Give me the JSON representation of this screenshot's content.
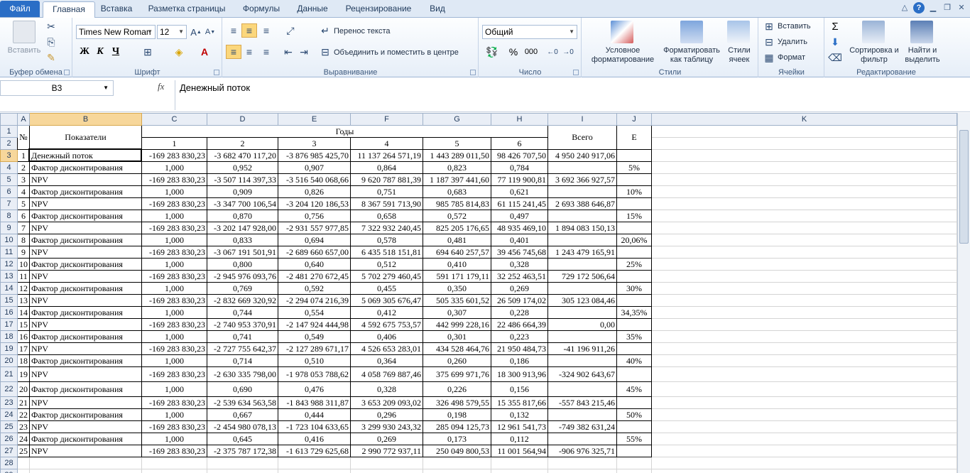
{
  "tabs": {
    "file": "Файл",
    "items": [
      "Главная",
      "Вставка",
      "Разметка страницы",
      "Формулы",
      "Данные",
      "Рецензирование",
      "Вид"
    ]
  },
  "ribbon": {
    "clipboard": {
      "paste": "Вставить",
      "label": "Буфер обмена"
    },
    "font": {
      "name": "Times New Roman",
      "size": "12",
      "bold": "Ж",
      "italic": "К",
      "underline": "Ч",
      "label": "Шрифт"
    },
    "alignment": {
      "wrap": "Перенос текста",
      "merge": "Объединить и поместить в центре",
      "label": "Выравнивание"
    },
    "number": {
      "format": "Общий",
      "percent": "%",
      "thousands": "000",
      "label": "Число"
    },
    "styles": {
      "conditional": "Условное форматирование",
      "table": "Форматировать как таблицу",
      "cell": "Стили ячеек",
      "label": "Стили"
    },
    "cells": {
      "insert": "Вставить",
      "delete": "Удалить",
      "format": "Формат",
      "label": "Ячейки"
    },
    "editing": {
      "sort": "Сортировка и фильтр",
      "find": "Найти и выделить",
      "label": "Редактирование"
    }
  },
  "formula_bar": {
    "namebox": "B3",
    "fx": "fx",
    "content": "Денежный поток"
  },
  "columns": [
    "A",
    "B",
    "C",
    "D",
    "E",
    "F",
    "G",
    "H",
    "I",
    "J",
    "K"
  ],
  "header": {
    "no": "№",
    "indicators": "Показатели",
    "years": "Годы",
    "year_numbers": [
      "1",
      "2",
      "3",
      "4",
      "5",
      "6"
    ],
    "total": "Всего",
    "e": "E"
  },
  "rows": [
    {
      "n": "1",
      "name": "Денежный поток",
      "v": [
        "-169 283 830,23",
        "-3 682 470 117,20",
        "-3 876 985 425,70",
        "11 137 264 571,19",
        "1 443 289 011,50",
        "98 426 707,50"
      ],
      "total": "4 950 240 917,06",
      "e": ""
    },
    {
      "n": "2",
      "name": "Фактор дисконтирования",
      "v": [
        "1,000",
        "0,952",
        "0,907",
        "0,864",
        "0,823",
        "0,784"
      ],
      "total": "",
      "e": "5%"
    },
    {
      "n": "3",
      "name": "NPV",
      "v": [
        "-169 283 830,23",
        "-3 507 114 397,33",
        "-3 516 540 068,66",
        "9 620 787 881,39",
        "1 187 397 441,60",
        "77 119 900,81"
      ],
      "total": "3 692 366 927,57",
      "e": ""
    },
    {
      "n": "4",
      "name": "Фактор дисконтирования",
      "v": [
        "1,000",
        "0,909",
        "0,826",
        "0,751",
        "0,683",
        "0,621"
      ],
      "total": "",
      "e": "10%"
    },
    {
      "n": "5",
      "name": "NPV",
      "v": [
        "-169 283 830,23",
        "-3 347 700 106,54",
        "-3 204 120 186,53",
        "8 367 591 713,90",
        "985 785 814,83",
        "61 115 241,45"
      ],
      "total": "2 693 388 646,87",
      "e": ""
    },
    {
      "n": "6",
      "name": "Фактор дисконтирования",
      "v": [
        "1,000",
        "0,870",
        "0,756",
        "0,658",
        "0,572",
        "0,497"
      ],
      "total": "",
      "e": "15%"
    },
    {
      "n": "7",
      "name": "NPV",
      "v": [
        "-169 283 830,23",
        "-3 202 147 928,00",
        "-2 931 557 977,85",
        "7 322 932 240,45",
        "825 205 176,65",
        "48 935 469,10"
      ],
      "total": "1 894 083 150,13",
      "e": ""
    },
    {
      "n": "8",
      "name": "Фактор дисконтирования",
      "v": [
        "1,000",
        "0,833",
        "0,694",
        "0,578",
        "0,481",
        "0,401"
      ],
      "total": "",
      "e": "20,06%"
    },
    {
      "n": "9",
      "name": "NPV",
      "v": [
        "-169 283 830,23",
        "-3 067 191 501,91",
        "-2 689 660 657,00",
        "6 435 518 151,81",
        "694 640 257,57",
        "39 456 745,68"
      ],
      "total": "1 243 479 165,91",
      "e": ""
    },
    {
      "n": "10",
      "name": "Фактор дисконтирования",
      "v": [
        "1,000",
        "0,800",
        "0,640",
        "0,512",
        "0,410",
        "0,328"
      ],
      "total": "",
      "e": "25%"
    },
    {
      "n": "11",
      "name": "NPV",
      "v": [
        "-169 283 830,23",
        "-2 945 976 093,76",
        "-2 481 270 672,45",
        "5 702 279 460,45",
        "591 171 179,11",
        "32 252 463,51"
      ],
      "total": "729 172 506,64",
      "e": ""
    },
    {
      "n": "12",
      "name": "Фактор дисконтирования",
      "v": [
        "1,000",
        "0,769",
        "0,592",
        "0,455",
        "0,350",
        "0,269"
      ],
      "total": "",
      "e": "30%"
    },
    {
      "n": "13",
      "name": "NPV",
      "v": [
        "-169 283 830,23",
        "-2 832 669 320,92",
        "-2 294 074 216,39",
        "5 069 305 676,47",
        "505 335 601,52",
        "26 509 174,02"
      ],
      "total": "305 123 084,46",
      "e": ""
    },
    {
      "n": "14",
      "name": "Фактор дисконтирования",
      "v": [
        "1,000",
        "0,744",
        "0,554",
        "0,412",
        "0,307",
        "0,228"
      ],
      "total": "",
      "e": "34,35%"
    },
    {
      "n": "15",
      "name": "NPV",
      "v": [
        "-169 283 830,23",
        "-2 740 953 370,91",
        "-2 147 924 444,98",
        "4 592 675 753,57",
        "442 999 228,16",
        "22 486 664,39"
      ],
      "total": "0,00",
      "e": ""
    },
    {
      "n": "16",
      "name": "Фактор дисконтирования",
      "v": [
        "1,000",
        "0,741",
        "0,549",
        "0,406",
        "0,301",
        "0,223"
      ],
      "total": "",
      "e": "35%"
    },
    {
      "n": "17",
      "name": "NPV",
      "v": [
        "-169 283 830,23",
        "-2 727 755 642,37",
        "-2 127 289 671,17",
        "4 526 653 283,01",
        "434 528 464,76",
        "21 950 484,73"
      ],
      "total": "-41 196 911,26",
      "e": ""
    },
    {
      "n": "18",
      "name": "Фактор дисконтирования",
      "v": [
        "1,000",
        "0,714",
        "0,510",
        "0,364",
        "0,260",
        "0,186"
      ],
      "total": "",
      "e": "40%"
    },
    {
      "n": "19",
      "name": "NPV",
      "v": [
        "-169 283 830,23",
        "-2 630 335 798,00",
        "-1 978 053 788,62",
        "4 058 769 887,46",
        "375 699 971,76",
        "18 300 913,96"
      ],
      "total": "-324 902 643,67",
      "e": ""
    },
    {
      "n": "20",
      "name": "Фактор дисконтирования",
      "v": [
        "1,000",
        "0,690",
        "0,476",
        "0,328",
        "0,226",
        "0,156"
      ],
      "total": "",
      "e": "45%"
    },
    {
      "n": "21",
      "name": "NPV",
      "v": [
        "-169 283 830,23",
        "-2 539 634 563,58",
        "-1 843 988 311,87",
        "3 653 209 093,02",
        "326 498 579,55",
        "15 355 817,66"
      ],
      "total": "-557 843 215,46",
      "e": ""
    },
    {
      "n": "22",
      "name": "Фактор дисконтирования",
      "v": [
        "1,000",
        "0,667",
        "0,444",
        "0,296",
        "0,198",
        "0,132"
      ],
      "total": "",
      "e": "50%"
    },
    {
      "n": "23",
      "name": "NPV",
      "v": [
        "-169 283 830,23",
        "-2 454 980 078,13",
        "-1 723 104 633,65",
        "3 299 930 243,32",
        "285 094 125,73",
        "12 961 541,73"
      ],
      "total": "-749 382 631,24",
      "e": ""
    },
    {
      "n": "24",
      "name": "Фактор дисконтирования",
      "v": [
        "1,000",
        "0,645",
        "0,416",
        "0,269",
        "0,173",
        "0,112"
      ],
      "total": "",
      "e": "55%"
    },
    {
      "n": "25",
      "name": "NPV",
      "v": [
        "-169 283 830,23",
        "-2 375 787 172,38",
        "-1 613 729 625,68",
        "2 990 772 937,11",
        "250 049 800,53",
        "11 001 564,94"
      ],
      "total": "-906 976 325,71",
      "e": ""
    }
  ]
}
